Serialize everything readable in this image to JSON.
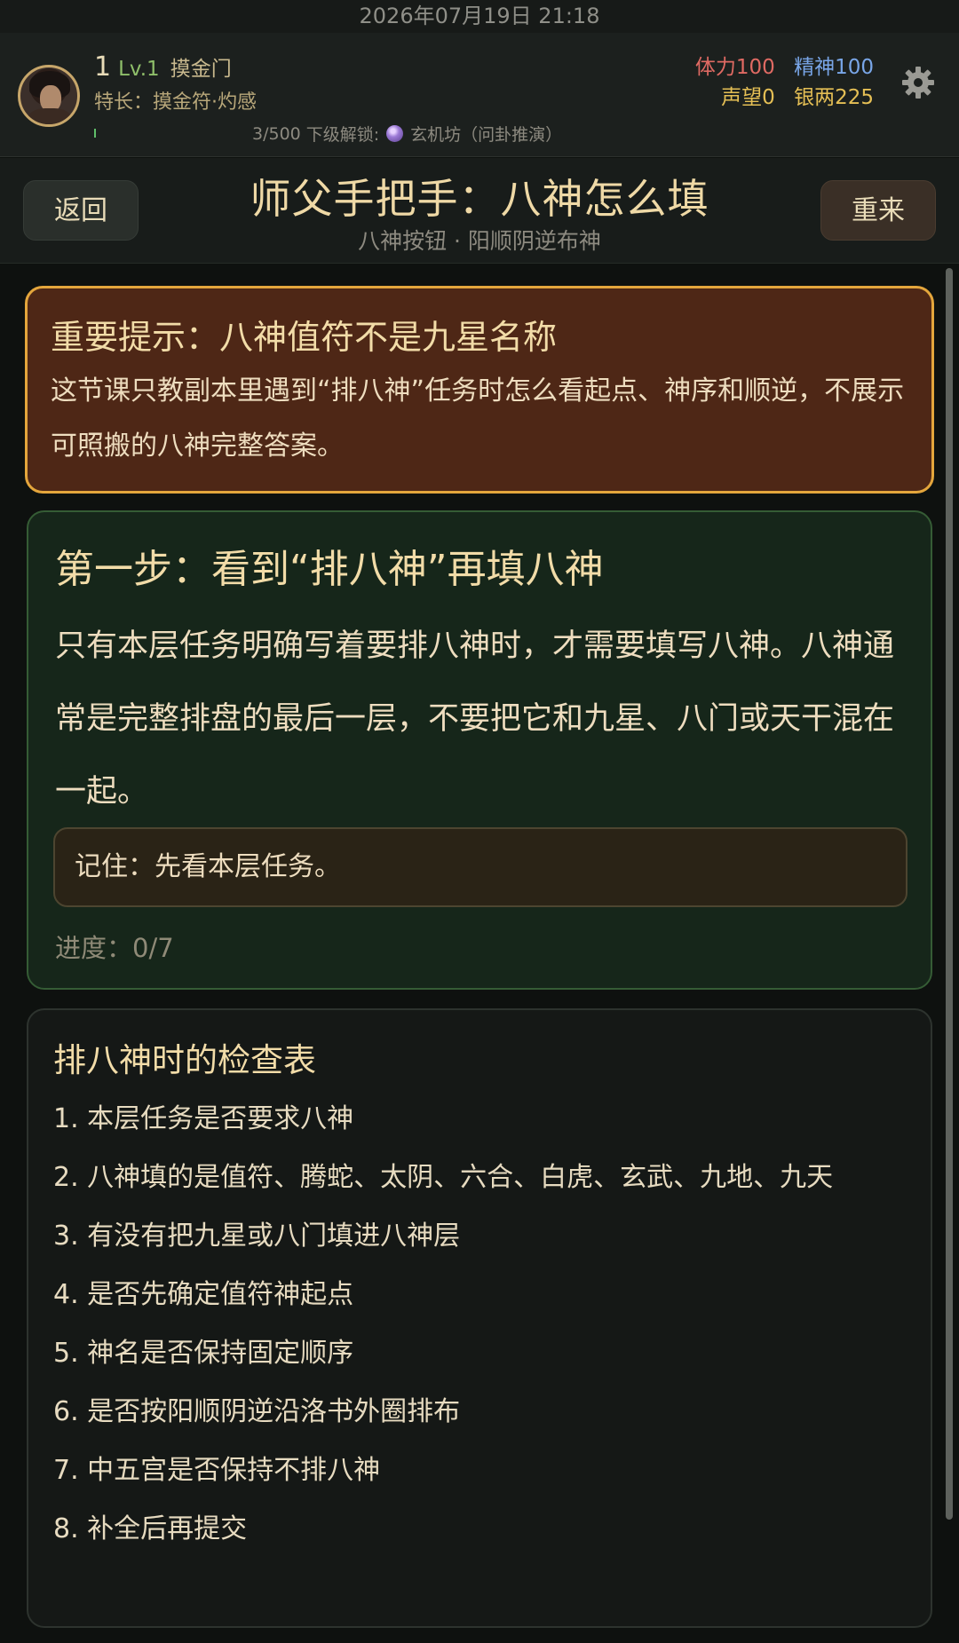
{
  "status_bar": {
    "datetime": "2026年07月19日 21:18"
  },
  "player": {
    "level_num": "1",
    "level_label": "Lv.1",
    "sect": "摸金门",
    "talent": "特长：摸金符·灼感",
    "exp": "3/500",
    "exp_fraction": 0.006,
    "unlock_prefix": "下级解锁:",
    "unlock_target": "玄机坊（问卦推演）"
  },
  "stats": {
    "stamina": "体力100",
    "spirit": "精神100",
    "reputation": "声望0",
    "silver": "银两225"
  },
  "header": {
    "back_label": "返回",
    "reset_label": "重来",
    "title": "师父手把手：八神怎么填",
    "subtitle": "八神按钮 · 阳顺阴逆布神"
  },
  "warning_card": {
    "title": "重要提示：八神值符不是九星名称",
    "body": "这节课只教副本里遇到“排八神”任务时怎么看起点、神序和顺逆，不展示可照搬的八神完整答案。"
  },
  "step_card": {
    "title": "第一步：看到“排八神”再填八神",
    "body": "只有本层任务明确写着要排八神时，才需要填写八神。八神通常是完整排盘的最后一层，不要把它和九星、八门或天干混在一起。",
    "memo": "记住：先看本层任务。",
    "progress": "进度：0/7"
  },
  "checklist": {
    "title": "排八神时的检查表",
    "items": [
      "1. 本层任务是否要求八神",
      "2. 八神填的是值符、腾蛇、太阴、六合、白虎、玄武、九地、九天",
      "3. 有没有把九星或八门填进八神层",
      "4. 是否先确定值符神起点",
      "5. 神名是否保持固定顺序",
      "6. 是否按阳顺阴逆沿洛书外圈排布",
      "7. 中五宫是否保持不排八神",
      "8. 补全后再提交"
    ]
  },
  "icons": {
    "settings": "gear-icon",
    "unlock": "crystal-ball-icon"
  },
  "colors": {
    "accent_gold": "#efd9a6",
    "warning_border": "#e4a63c",
    "step_border": "#355c35"
  }
}
